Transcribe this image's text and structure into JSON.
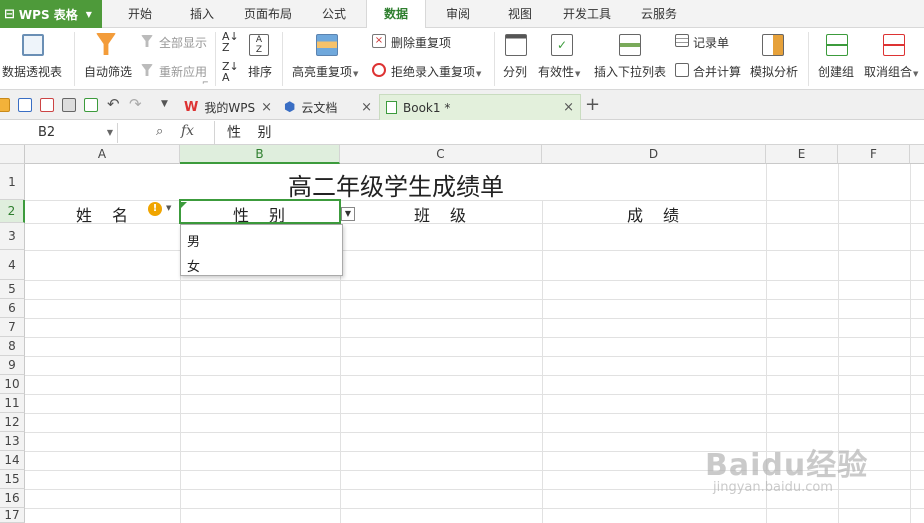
{
  "app": {
    "name": "WPS 表格"
  },
  "menu": {
    "tabs": [
      "开始",
      "插入",
      "页面布局",
      "公式",
      "数据",
      "审阅",
      "视图",
      "开发工具",
      "云服务"
    ],
    "active": "数据"
  },
  "ribbon": {
    "pivot_table": "数据透视表",
    "auto_filter": "自动筛选",
    "show_all": "全部显示",
    "reapply": "重新应用",
    "sort": "排序",
    "highlight_dup": "高亮重复项",
    "delete_dup": "删除重复项",
    "reject_dup": "拒绝录入重复项",
    "split_column": "分列",
    "validity": "有效性",
    "insert_dropdown": "插入下拉列表",
    "record_sheet": "记录单",
    "merge_calc": "合并计算",
    "simulation": "模拟分析",
    "create_group": "创建组",
    "ungroup": "取消组合"
  },
  "doc_tabs": [
    {
      "label": "我的WPS"
    },
    {
      "label": "云文档"
    },
    {
      "label": "Book1 *"
    }
  ],
  "formula_bar": {
    "name_box": "B2",
    "fx": "fx",
    "content": "性 别"
  },
  "columns": [
    "A",
    "B",
    "C",
    "D",
    "E",
    "F"
  ],
  "rows": [
    "1",
    "2",
    "3",
    "4",
    "5",
    "6",
    "7",
    "8",
    "9",
    "10",
    "11",
    "12",
    "13",
    "14",
    "15",
    "16",
    "17"
  ],
  "cells": {
    "title": "高二年级学生成绩单",
    "a2": "姓　名",
    "b2": "性　别",
    "c2": "班　级",
    "d2": "成　绩"
  },
  "dropdown": {
    "options": [
      "男",
      "女"
    ]
  },
  "watermark": {
    "brand": "Baidu经验",
    "url": "jingyan.baidu.com"
  },
  "colors": {
    "accent": "#3c9b3c",
    "app_button": "#4e9a3a",
    "warning": "#f0a500"
  }
}
